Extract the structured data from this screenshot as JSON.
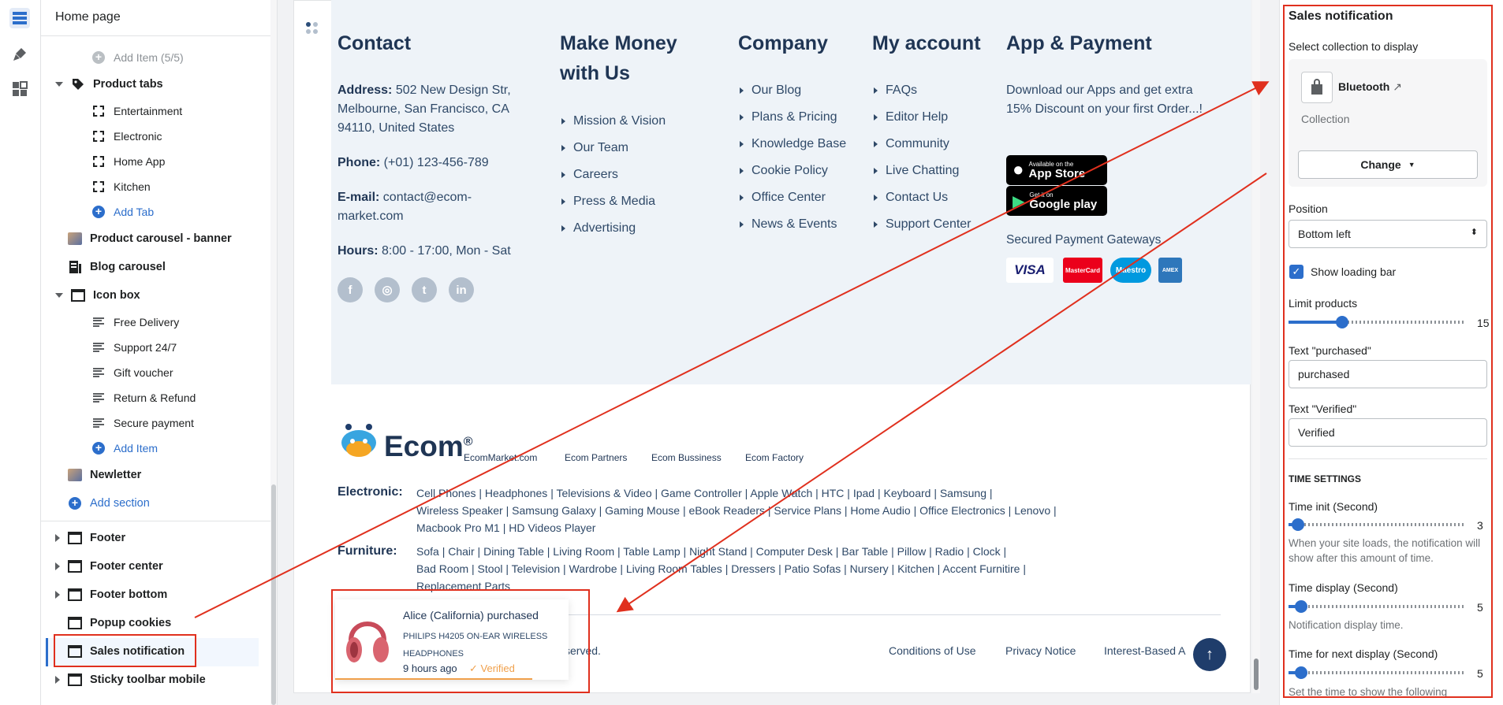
{
  "sidebar": {
    "title": "Home page",
    "items": [
      {
        "label": "Add Item (5/5)"
      },
      {
        "label": "Product tabs"
      },
      {
        "label": "Entertainment"
      },
      {
        "label": "Electronic"
      },
      {
        "label": "Home App"
      },
      {
        "label": "Kitchen"
      },
      {
        "label": "Add Tab"
      },
      {
        "label": "Product carousel - banner"
      },
      {
        "label": "Blog carousel"
      },
      {
        "label": "Icon box"
      },
      {
        "label": "Free Delivery"
      },
      {
        "label": "Support 24/7"
      },
      {
        "label": "Gift voucher"
      },
      {
        "label": "Return & Refund"
      },
      {
        "label": "Secure payment"
      },
      {
        "label": "Add Item"
      },
      {
        "label": "Newletter"
      },
      {
        "label": "Add section"
      },
      {
        "label": "Footer"
      },
      {
        "label": "Footer center"
      },
      {
        "label": "Footer bottom"
      },
      {
        "label": "Popup cookies"
      },
      {
        "label": "Sales notification"
      },
      {
        "label": "Sticky toolbar mobile"
      }
    ]
  },
  "preview": {
    "contact": {
      "heading": "Contact",
      "address_label": "Address:",
      "address": "502 New Design Str, Melbourne, San Francisco, CA 94110, United States",
      "phone_label": "Phone:",
      "phone": "(+01) 123-456-789",
      "email_label": "E-mail:",
      "email": "contact@ecom-market.com",
      "hours_label": "Hours:",
      "hours": "8:00 - 17:00, Mon - Sat",
      "social": [
        "f",
        "◎",
        "t",
        "in"
      ]
    },
    "make_money": {
      "heading_1": "Make Money",
      "heading_2": "with Us",
      "links": [
        "Mission & Vision",
        "Our Team",
        "Careers",
        "Press & Media",
        "Advertising"
      ]
    },
    "company": {
      "heading": "Company",
      "links": [
        "Our Blog",
        "Plans & Pricing",
        "Knowledge Base",
        "Cookie Policy",
        "Office Center",
        "News & Events"
      ]
    },
    "account": {
      "heading": "My account",
      "links": [
        "FAQs",
        "Editor Help",
        "Community",
        "Live Chatting",
        "Contact Us",
        "Support Center"
      ]
    },
    "app": {
      "heading": "App & Payment",
      "text": "Download our Apps and get extra 15% Discount on your first Order...!",
      "appstore_small": "Available on the",
      "appstore_big": "App Store",
      "gplay_small": "Get it on",
      "gplay_big": "Google play",
      "gateways_label": "Secured Payment Gateways",
      "cards": [
        "VISA",
        "MasterCard",
        "Maestro",
        "AMEX"
      ]
    },
    "logo": {
      "text": "Ecom",
      "reg": "®"
    },
    "partners": [
      "EcomMarket.com",
      "Ecom Partners",
      "Ecom Bussiness",
      "Ecom Factory"
    ],
    "electronic": {
      "label": "Electronic:",
      "line1": "Cell Phones   |   Headphones   |   Televisions & Video   |   Game Controller   |   Apple Watch   |   HTC   |   Ipad   |   Keyboard   |   Samsung   |",
      "line2": "Wireless Speaker   |   Samsung Galaxy   |   Gaming Mouse   |   eBook Readers   |   Service Plans   |   Home Audio   |   Office Electronics   |   Lenovo   |",
      "line3": "Macbook Pro M1   |   HD Videos Player"
    },
    "furniture": {
      "label": "Furniture:",
      "line1": "Sofa   |   Chair   |   Dining Table   |   Living Room   |   Table Lamp   |   Night Stand   |   Computer Desk   |   Bar Table   |   Pillow   |   Radio   |   Clock   |",
      "line2": "Bad Room   |   Stool   |   Television   |   Wardrobe   |   Living Room Tables   |   Dressers   |   Patio Sofas   |   Nursery   |   Kitchen   |   Accent Furnitire   |",
      "line3": "Replacement Parts"
    },
    "copyright_tail": "served.",
    "bottom_links": [
      "Conditions of Use",
      "Privacy Notice",
      "Interest-Based A"
    ],
    "to_top": "↑",
    "notification": {
      "buyer": "Alice (California) purchased",
      "product": "PHILIPS H4205 ON-EAR WIRELESS HEADPHONES",
      "time": "9 hours ago",
      "verified": "Verified"
    }
  },
  "settings": {
    "title": "Sales notification",
    "collection_label": "Select collection to display",
    "collection_name": "Bluetooth",
    "collection_type": "Collection",
    "change_button": "Change",
    "position_label": "Position",
    "position_value": "Bottom left",
    "show_loading_bar": "Show loading bar",
    "show_loading_bar_checked": true,
    "limit_label": "Limit products",
    "limit_value": "15",
    "limit_fraction": 0.3,
    "purchased_label": "Text \"purchased\"",
    "purchased_value": "purchased",
    "verified_label": "Text \"Verified\"",
    "verified_value": "Verified",
    "time_settings": "TIME SETTINGS",
    "time_init_label": "Time init (Second)",
    "time_init_value": "3",
    "time_init_help": "When your site loads, the notification will show after this amount of time.",
    "time_display_label": "Time display (Second)",
    "time_display_value": "5",
    "time_display_help": "Notification display time.",
    "time_next_label": "Time for next display (Second)",
    "time_next_value": "5",
    "time_next_help": "Set the time to show the following"
  },
  "colors": {
    "accent": "#2c6ecb",
    "annotation": "#e0301e",
    "footer_bg": "#eef3f8"
  }
}
